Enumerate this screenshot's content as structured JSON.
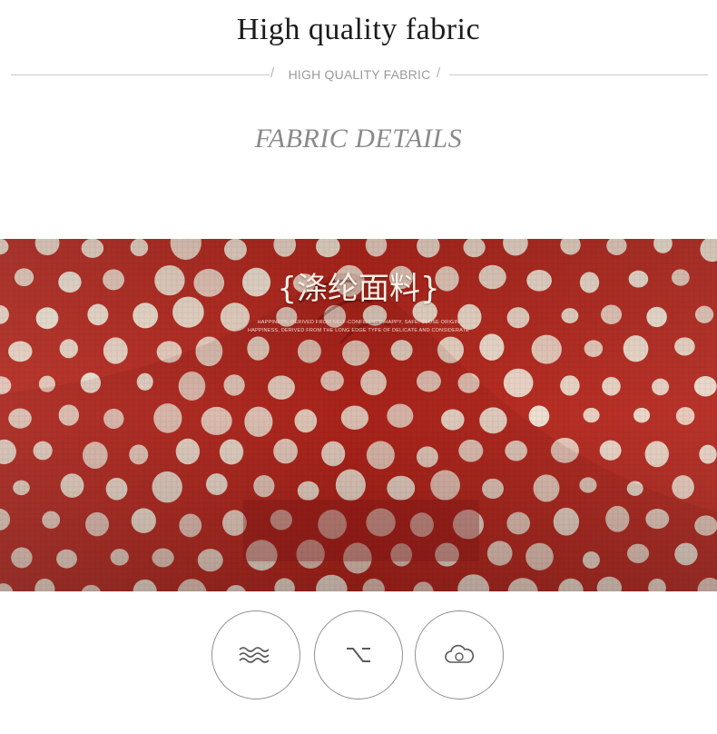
{
  "header": {
    "title": "High quality fabric",
    "subtitle": "HIGH QUALITY FABRIC",
    "slash_left": "/",
    "slash_right": "/"
  },
  "section": {
    "heading": "FABRIC DETAILS"
  },
  "photo": {
    "caption_main": "{涤纶面料}",
    "caption_line1": "HAPPINESS, DERIVED FROM SELF-CONFIDENCE,HAPPY, SAFE, CLOSE ORIGIN",
    "caption_line2": "HAPPINESS, DERIVED FROM THE LONG EDGE TYPE OF DELICATE AND CONSIDERATE",
    "fabric_color": "#b5271d",
    "dot_color": "#efe3d3"
  },
  "feature_icons": [
    {
      "icon": "wave-icon"
    },
    {
      "icon": "option-key-icon"
    },
    {
      "icon": "cloud-icon"
    }
  ],
  "colors": {
    "title": "#1b1b1b",
    "subtitle": "#9a9a9a",
    "heading": "#8a8a8a",
    "icon_stroke": "#5a5a5a"
  }
}
